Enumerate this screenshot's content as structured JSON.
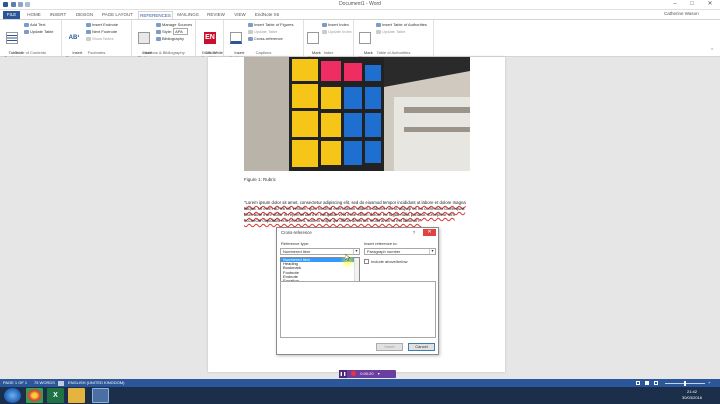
{
  "window": {
    "title": "Document1 - Word",
    "user": "Catherine Wason"
  },
  "tabs": [
    "FILE",
    "HOME",
    "INSERT",
    "DESIGN",
    "PAGE LAYOUT",
    "REFERENCES",
    "MAILINGS",
    "REVIEW",
    "VIEW",
    "EndNote X6"
  ],
  "ribbon": {
    "toc": {
      "table_of_contents": "Table of\nContents",
      "add_text": "Add Text",
      "update_table": "Update Table",
      "label": "Table of Contents"
    },
    "footnotes": {
      "insert_footnote": "Insert\nFootnote",
      "insert_endnote": "Insert Endnote",
      "next_footnote": "Next Footnote",
      "show_notes": "Show Notes",
      "label": "Footnotes"
    },
    "citations": {
      "insert_citation": "Insert\nCitation",
      "manage_sources": "Manage Sources",
      "style_label": "Style:",
      "style_value": "APA",
      "bibliography": "Bibliography",
      "label": "Citations & Bibliography"
    },
    "endnote": {
      "cite_while_you_write": "Cite While\nYou Write",
      "label": "EndNote"
    },
    "captions": {
      "insert_caption": "Insert\nCaption",
      "insert_table_of_figures": "Insert Table of Figures",
      "update_table": "Update Table",
      "cross_reference": "Cross-reference",
      "label": "Captions"
    },
    "index": {
      "mark_entry": "Mark\nEntry",
      "insert_index": "Insert Index",
      "update_index": "Update Index",
      "label": "Index"
    },
    "authorities": {
      "mark_citation": "Mark\nCitation",
      "insert_table_of_authorities": "Insert Table of Authorities",
      "update_table": "Update Table",
      "label": "Table of Authorities"
    }
  },
  "document": {
    "caption": "Figure 1: Rubric",
    "body": "\"Lorem ipsum dolor sit amet, consectetur adipiscing elit, sed do eiusmod tempor incididunt ut labore et dolore magna aliqua. Ut enim ad minim veniam, quis nostrud exercitation ullamco laboris nisi ut aliquip ex ea commodo consequat. Duis aute irure dolor in reprehenderit in voluptate velit esse cillum dolore eu fugiat nulla pariatur. Excepteur sint occaecat cupidatat non proident, sunt in culpa qui officia deserunt mollit anim id est laborum.\""
  },
  "dialog": {
    "title": "Cross-reference",
    "help": "?",
    "close": "✕",
    "reference_type_label": "Reference type:",
    "reference_type_value": "Numbered item",
    "insert_reference_label": "Insert reference to:",
    "insert_reference_value": "Paragraph number",
    "list_items": [
      "Numbered item",
      "Heading",
      "Bookmark",
      "Footnote",
      "Endnote",
      "Equation"
    ],
    "include_above_below": "Include above/below",
    "insert_button": "Insert",
    "cancel_button": "Cancel"
  },
  "recorder": {
    "time": "0:00:20"
  },
  "statusbar": {
    "page": "PAGE 1 OF 1",
    "words": "75 WORDS",
    "language": "ENGLISH (UNITED KINGDOM)",
    "zoom": "+"
  },
  "taskbar": {
    "time": "21:42",
    "date": "30/03/2016"
  },
  "colors": {
    "accent": "#2b579a",
    "selection": "#3399ff",
    "recorder": "#6b3fa0",
    "close": "#e04343"
  }
}
